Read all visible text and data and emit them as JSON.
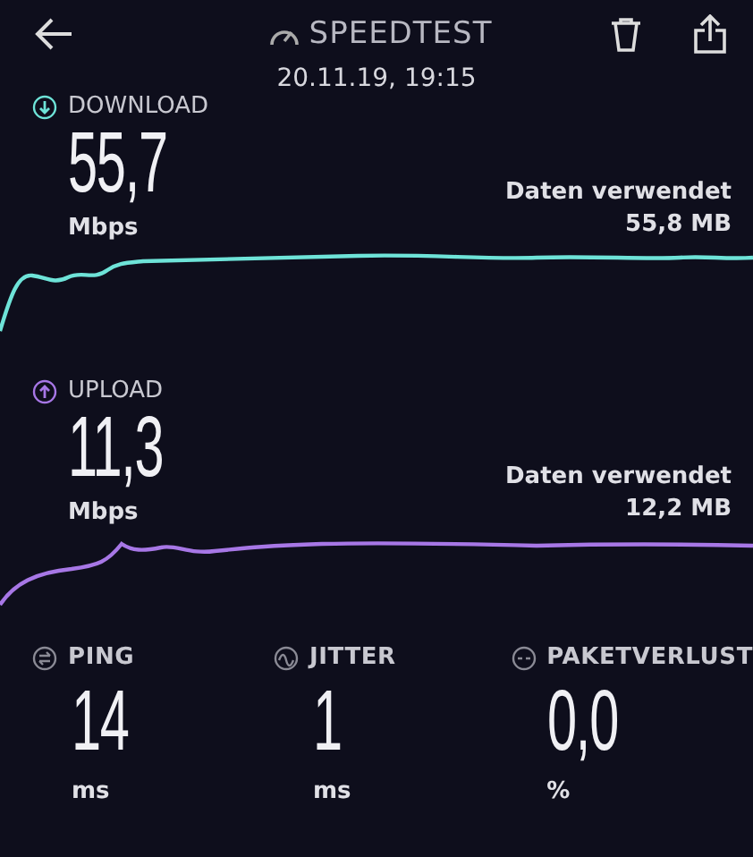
{
  "header": {
    "title": "SPEEDTEST",
    "date": "20.11.19, 19:15"
  },
  "tests": [
    {
      "kind": "download",
      "label": "DOWNLOAD",
      "value": "55,7",
      "unit": "Mbps",
      "data_label": "Daten verwendet",
      "data_value": "55,8 MB"
    },
    {
      "kind": "upload",
      "label": "UPLOAD",
      "value": "11,3",
      "unit": "Mbps",
      "data_label": "Daten verwendet",
      "data_value": "12,2 MB"
    }
  ],
  "metrics": [
    {
      "kind": "ping",
      "label": "PING",
      "value": "14",
      "unit": "ms"
    },
    {
      "kind": "jitter",
      "label": "JITTER",
      "value": "1",
      "unit": "ms"
    },
    {
      "kind": "loss",
      "label": "PAKETVERLUST",
      "value": "0,0",
      "unit": "%"
    }
  ]
}
